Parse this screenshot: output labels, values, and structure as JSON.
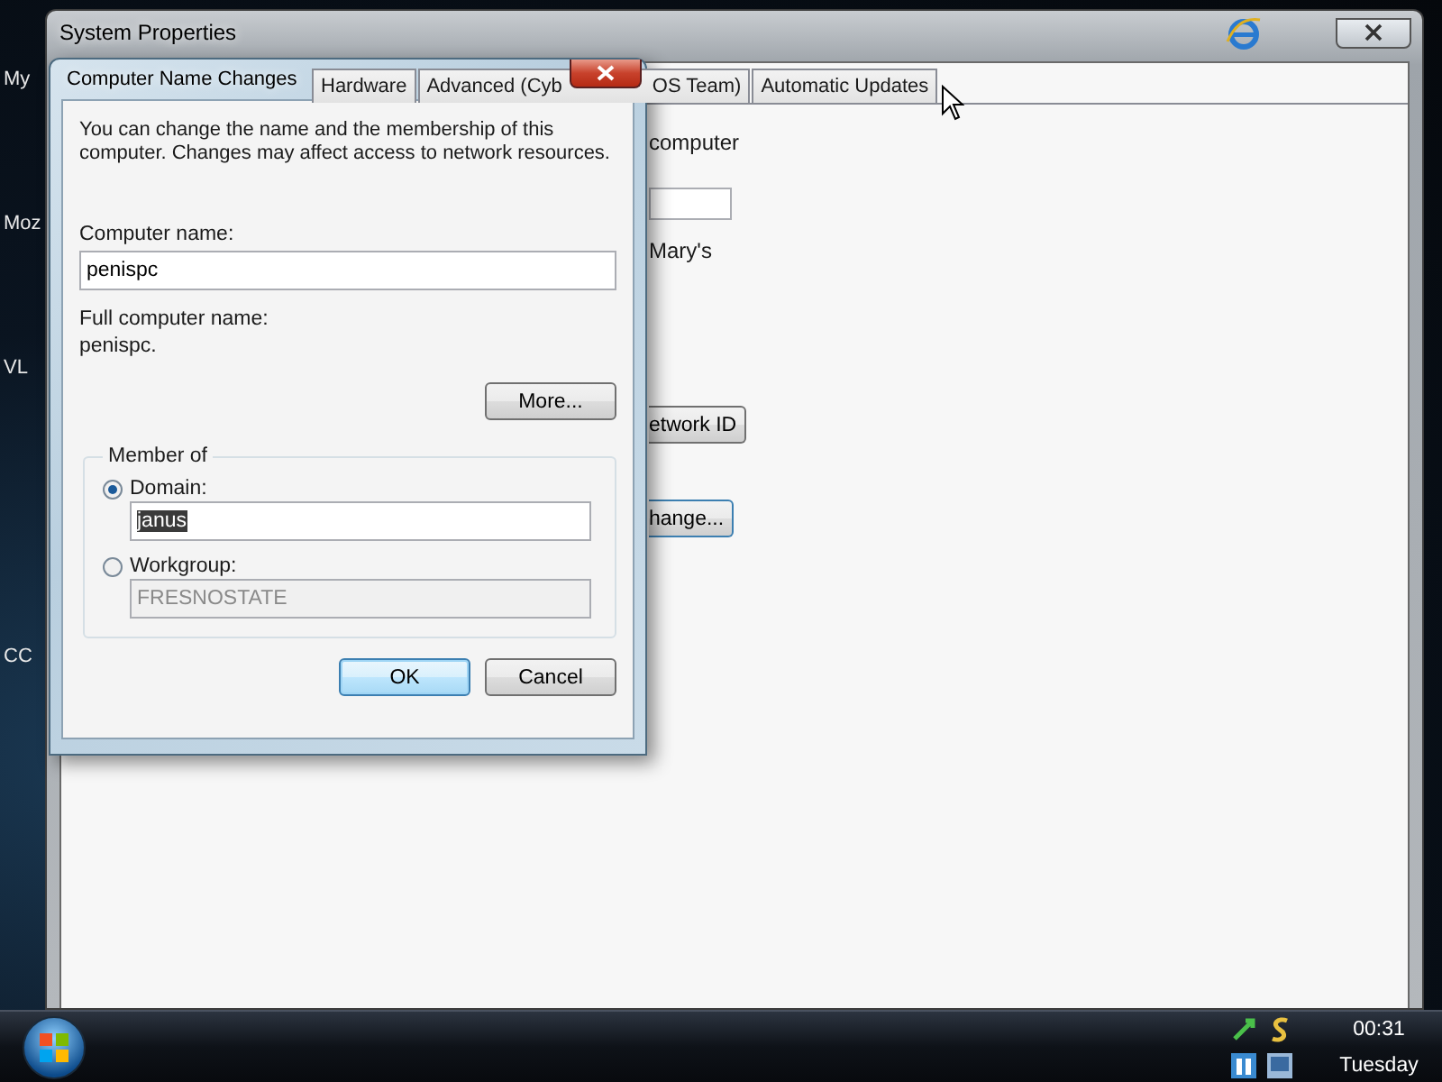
{
  "desktop": {
    "icon_labels": [
      "My",
      "Moz",
      "VL",
      "CC"
    ]
  },
  "system_properties": {
    "title": "System Properties",
    "tabs": [
      {
        "label": "Hardware",
        "selected": false
      },
      {
        "label": "Advanced (Cyb",
        "label_tail": "OS Team)",
        "selected": false
      },
      {
        "label": "Automatic Updates",
        "selected": false
      }
    ],
    "fragments": {
      "text_1": "computer",
      "text_2": "Mary's",
      "button_1": "etwork ID",
      "button_2": "hange..."
    }
  },
  "dialog": {
    "title": "Computer Name Changes",
    "intro": "You can change the name and the membership of this computer. Changes may affect access to network resources.",
    "computer_name_label": "Computer name:",
    "computer_name": "penispc",
    "full_name_label": "Full computer name:",
    "full_name": "penispc.",
    "more_button": "More...",
    "member_of": {
      "title": "Member of",
      "options": [
        {
          "label": "Domain:",
          "selected": true,
          "value": "janus"
        },
        {
          "label": "Workgroup:",
          "selected": false,
          "value": "FRESNOSTATE"
        }
      ]
    },
    "buttons": [
      {
        "label": "OK",
        "default": true
      },
      {
        "label": "Cancel",
        "default": false
      }
    ]
  },
  "taskbar": {
    "time": "00:31",
    "day": "Tuesday"
  }
}
